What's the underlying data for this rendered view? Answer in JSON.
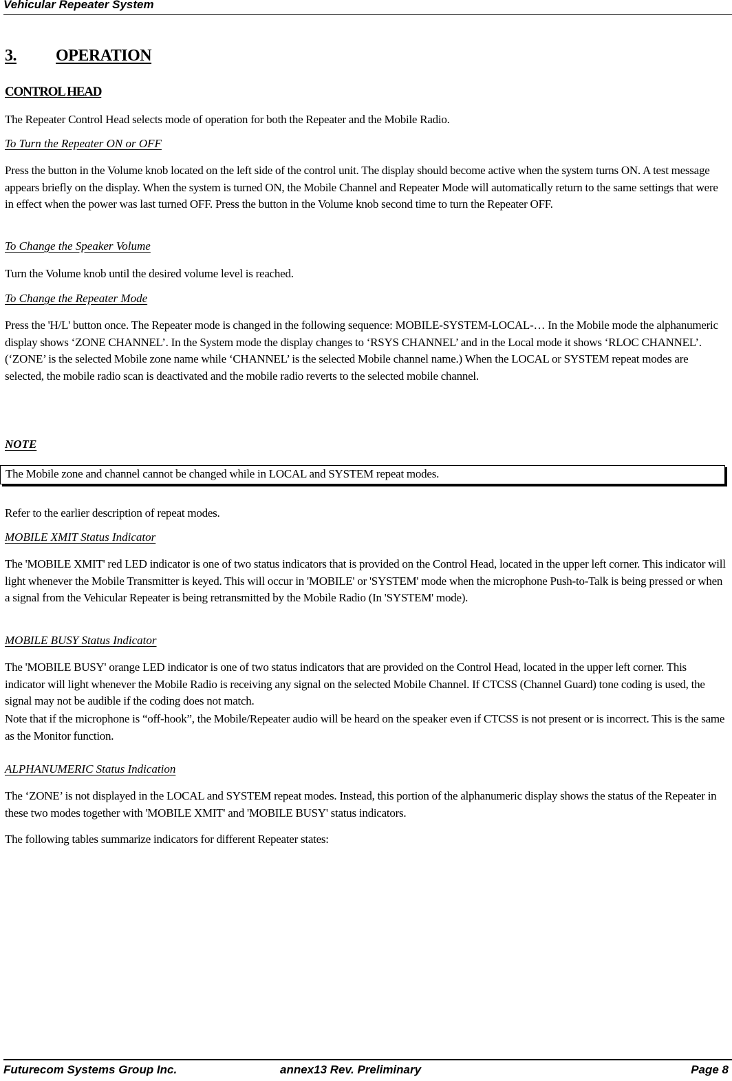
{
  "header": {
    "title": "Vehicular Repeater System"
  },
  "section": {
    "number": "3.",
    "title": "OPERATION"
  },
  "control_head": {
    "heading": "CONTROL HEAD",
    "intro": "The Repeater Control Head selects mode of operation for both the Repeater and the Mobile Radio."
  },
  "subsections": [
    {
      "heading": "To Turn the Repeater ON or OFF",
      "paragraphs": [
        "Press the button in the Volume knob located on the left side of the control unit. The display should become active when the system turns ON. A test message appears briefly on the display. When the system is turned ON, the Mobile Channel and Repeater Mode will automatically return to the same settings that were in effect when the power was last turned OFF. Press the button in the Volume knob second time to turn the Repeater OFF."
      ]
    },
    {
      "heading": "To Change the Speaker Volume",
      "paragraphs": [
        "Turn the Volume knob until the desired volume level is reached."
      ]
    },
    {
      "heading": "To Change the Repeater Mode",
      "paragraphs": [
        "Press the 'H/L' button once. The Repeater mode is changed in the following sequence: MOBILE-SYSTEM-LOCAL-… In the Mobile mode the alphanumeric display shows ‘ZONE CHANNEL’. In the System mode the display changes to ‘RSYS CHANNEL’ and in the Local mode it shows ‘RLOC CHANNEL’. (‘ZONE’ is the selected Mobile zone name while ‘CHANNEL’ is the selected Mobile channel name.) When the LOCAL or SYSTEM repeat modes are selected, the mobile radio scan is deactivated and the mobile radio reverts to the selected mobile channel."
      ]
    },
    {
      "heading": "MOBILE XMIT Status Indicator",
      "paragraphs": [
        "The 'MOBILE XMIT' red LED indicator is one of two status indicators that is provided on the Control Head, located in the upper left corner. This indicator will light whenever the Mobile Transmitter is keyed. This will occur in 'MOBILE' or 'SYSTEM' mode when the microphone Push-to-Talk is being pressed or when a signal from the Vehicular Repeater is being retransmitted by the Mobile Radio (In 'SYSTEM' mode)."
      ]
    },
    {
      "heading": "MOBILE BUSY Status Indicator",
      "paragraphs": [
        "The 'MOBILE BUSY' orange LED indicator is one of two status indicators that are provided on the Control Head, located in the upper left corner. This indicator will light whenever the Mobile Radio is receiving any signal on the selected Mobile Channel. If CTCSS (Channel Guard) tone coding is used, the signal may not be audible if the coding does not match.",
        "Note that if the microphone is “off-hook”, the Mobile/Repeater audio will be heard on the speaker even if CTCSS is not present or is incorrect. This is the same as the Monitor function."
      ]
    },
    {
      "heading": "ALPHANUMERIC Status Indication",
      "paragraphs": [
        "The ‘ZONE’ is not displayed in the LOCAL and SYSTEM repeat modes. Instead, this portion of the alphanumeric display shows the status of the Repeater in these two modes together with 'MOBILE XMIT' and  'MOBILE BUSY' status indicators.",
        "The following tables summarize indicators for different Repeater states:"
      ]
    }
  ],
  "note": {
    "label": "NOTE",
    "text": "The Mobile zone and channel cannot be changed while in LOCAL and SYSTEM repeat modes.",
    "after": "Refer to the earlier description of repeat modes."
  },
  "footer": {
    "company": "Futurecom Systems Group Inc.",
    "doc": "annex13 Rev. Preliminary",
    "page": "Page 8"
  }
}
